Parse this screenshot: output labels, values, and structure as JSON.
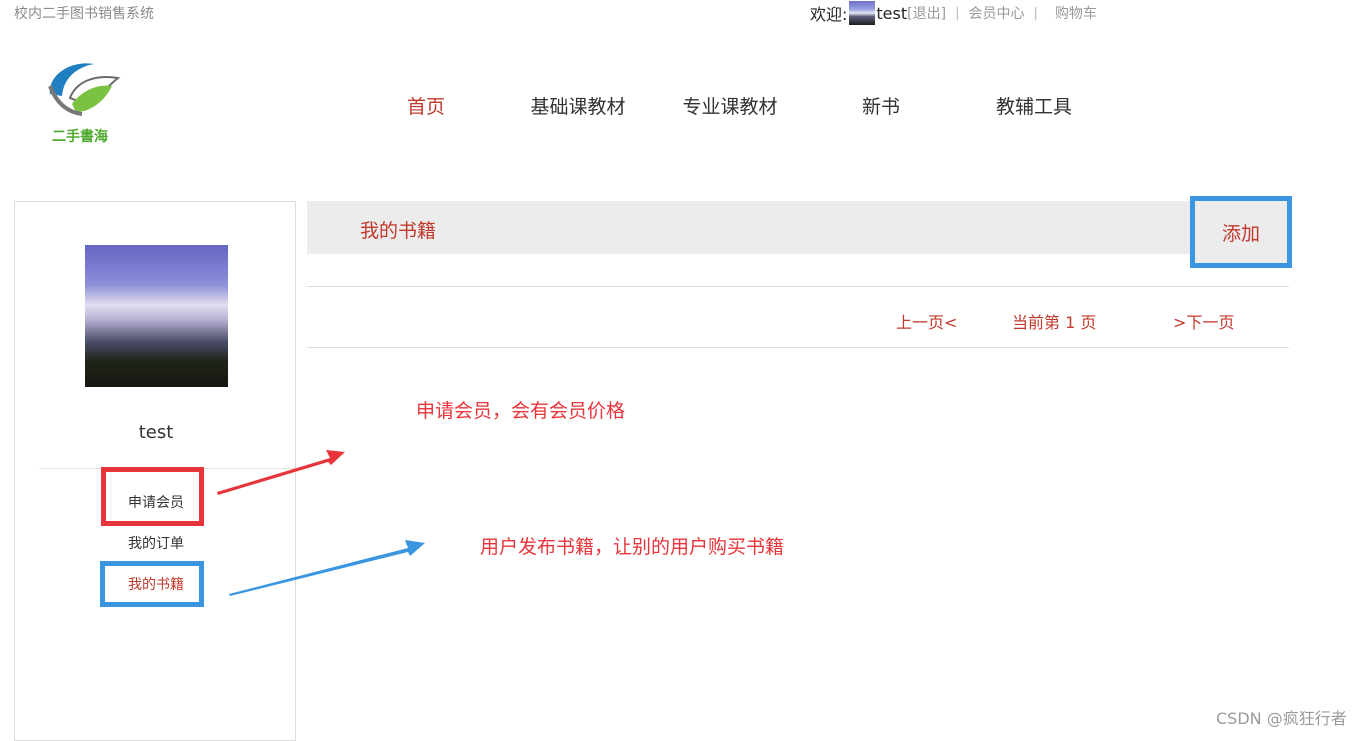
{
  "header": {
    "site_title": "校内二手图书销售系统",
    "welcome": "欢迎:",
    "username": "test",
    "logout": "[退出]",
    "member_center": "会员中心",
    "cart": "购物车"
  },
  "logo": {
    "text": "二手書海"
  },
  "nav": [
    {
      "label": "首页",
      "active": true
    },
    {
      "label": "基础课教材"
    },
    {
      "label": "专业课教材"
    },
    {
      "label": "新书"
    },
    {
      "label": "教辅工具"
    }
  ],
  "sidebar": {
    "name": "test",
    "links": [
      {
        "label": "申请会员"
      },
      {
        "label": "我的订单"
      },
      {
        "label": "我的书籍",
        "active": true
      }
    ]
  },
  "main": {
    "title": "我的书籍",
    "add_button": "添加",
    "pager": {
      "prev": "上一页<",
      "current": "当前第 1 页",
      "next": ">下一页"
    }
  },
  "annotations": {
    "member_note": "申请会员，会有会员价格",
    "books_note": "用户发布书籍，让别的用户购买书籍"
  },
  "watermark": "CSDN @疯狂行者",
  "colors": {
    "accent_red": "#c0392b",
    "annotation_red": "#e8353b",
    "annotation_blue": "#3a96e0"
  }
}
